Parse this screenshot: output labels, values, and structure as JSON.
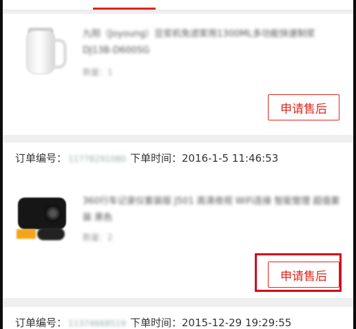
{
  "order_list": [
    {
      "product": {
        "title": "九阳（Joyoung）豆浆机免滤家用1300ML多功能快速制浆DJ13B-D600SG",
        "quantity": "数量：1"
      },
      "after_sales_label": "申请售后"
    },
    {
      "order_number_label": "订单编号：",
      "order_number_value": "11778291080",
      "order_time_label": "下单时间：",
      "order_time_value": "2016-1-5 11:46:53",
      "product": {
        "title": "360行车记录仪套装版 J501 高清夜视 WiFi连接 智能管理 超值套装 黑色",
        "quantity": "数量：2"
      },
      "after_sales_label": "申请售后"
    },
    {
      "order_number_label": "订单编号：",
      "order_number_value": "11374668519",
      "order_time_label": "下单时间：",
      "order_time_value": "2015-12-29 19:29:55"
    }
  ],
  "colors": {
    "accent": "#e2231a",
    "highlight": "#d0021b",
    "background": "#efefef"
  }
}
